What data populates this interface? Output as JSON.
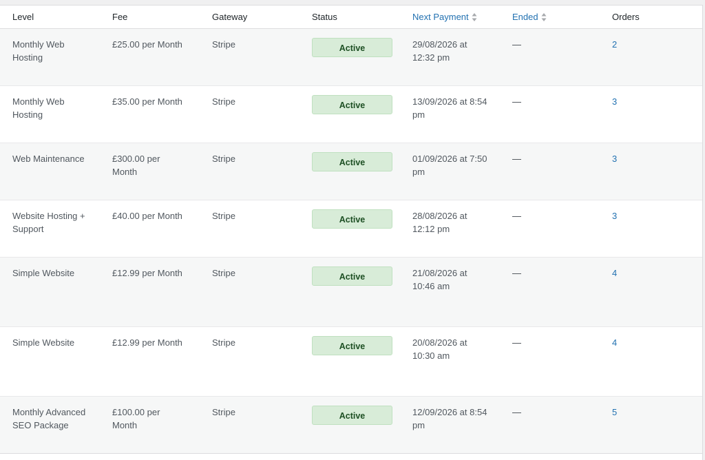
{
  "columns": {
    "level": "Level",
    "fee": "Fee",
    "gateway": "Gateway",
    "status": "Status",
    "next_payment": "Next Payment",
    "ended": "Ended",
    "orders": "Orders"
  },
  "icons": {
    "sort": "sort-arrows-icon"
  },
  "colors": {
    "link": "#2271b1",
    "badge_bg": "#d8ecd8",
    "badge_text": "#1d4f23"
  },
  "rows": [
    {
      "level": "Monthly Web Hosting",
      "fee": "£25.00 per Month",
      "gateway": "Stripe",
      "status": "Active",
      "next_payment": "29/08/2026 at 12:32 pm",
      "ended": "—",
      "orders": "2"
    },
    {
      "level": "Monthly Web Hosting",
      "fee": "£35.00 per Month",
      "gateway": "Stripe",
      "status": "Active",
      "next_payment": "13/09/2026 at 8:54 pm",
      "ended": "—",
      "orders": "3"
    },
    {
      "level": "Web Maintenance",
      "fee": "£300.00 per Month",
      "gateway": "Stripe",
      "status": "Active",
      "next_payment": "01/09/2026 at 7:50 pm",
      "ended": "—",
      "orders": "3"
    },
    {
      "level": "Website Hosting + Support",
      "fee": "£40.00 per Month",
      "gateway": "Stripe",
      "status": "Active",
      "next_payment": "28/08/2026 at 12:12 pm",
      "ended": "—",
      "orders": "3"
    },
    {
      "level": "Simple Website",
      "fee": "£12.99 per Month",
      "gateway": "Stripe",
      "status": "Active",
      "next_payment": "21/08/2026 at 10:46 am",
      "ended": "—",
      "orders": "4"
    },
    {
      "level": "Simple Website",
      "fee": "£12.99 per Month",
      "gateway": "Stripe",
      "status": "Active",
      "next_payment": "20/08/2026 at 10:30 am",
      "ended": "—",
      "orders": "4"
    },
    {
      "level": "Monthly Advanced SEO Package",
      "fee": "£100.00 per Month",
      "gateway": "Stripe",
      "status": "Active",
      "next_payment": "12/09/2026 at 8:54 pm",
      "ended": "—",
      "orders": "5"
    }
  ]
}
